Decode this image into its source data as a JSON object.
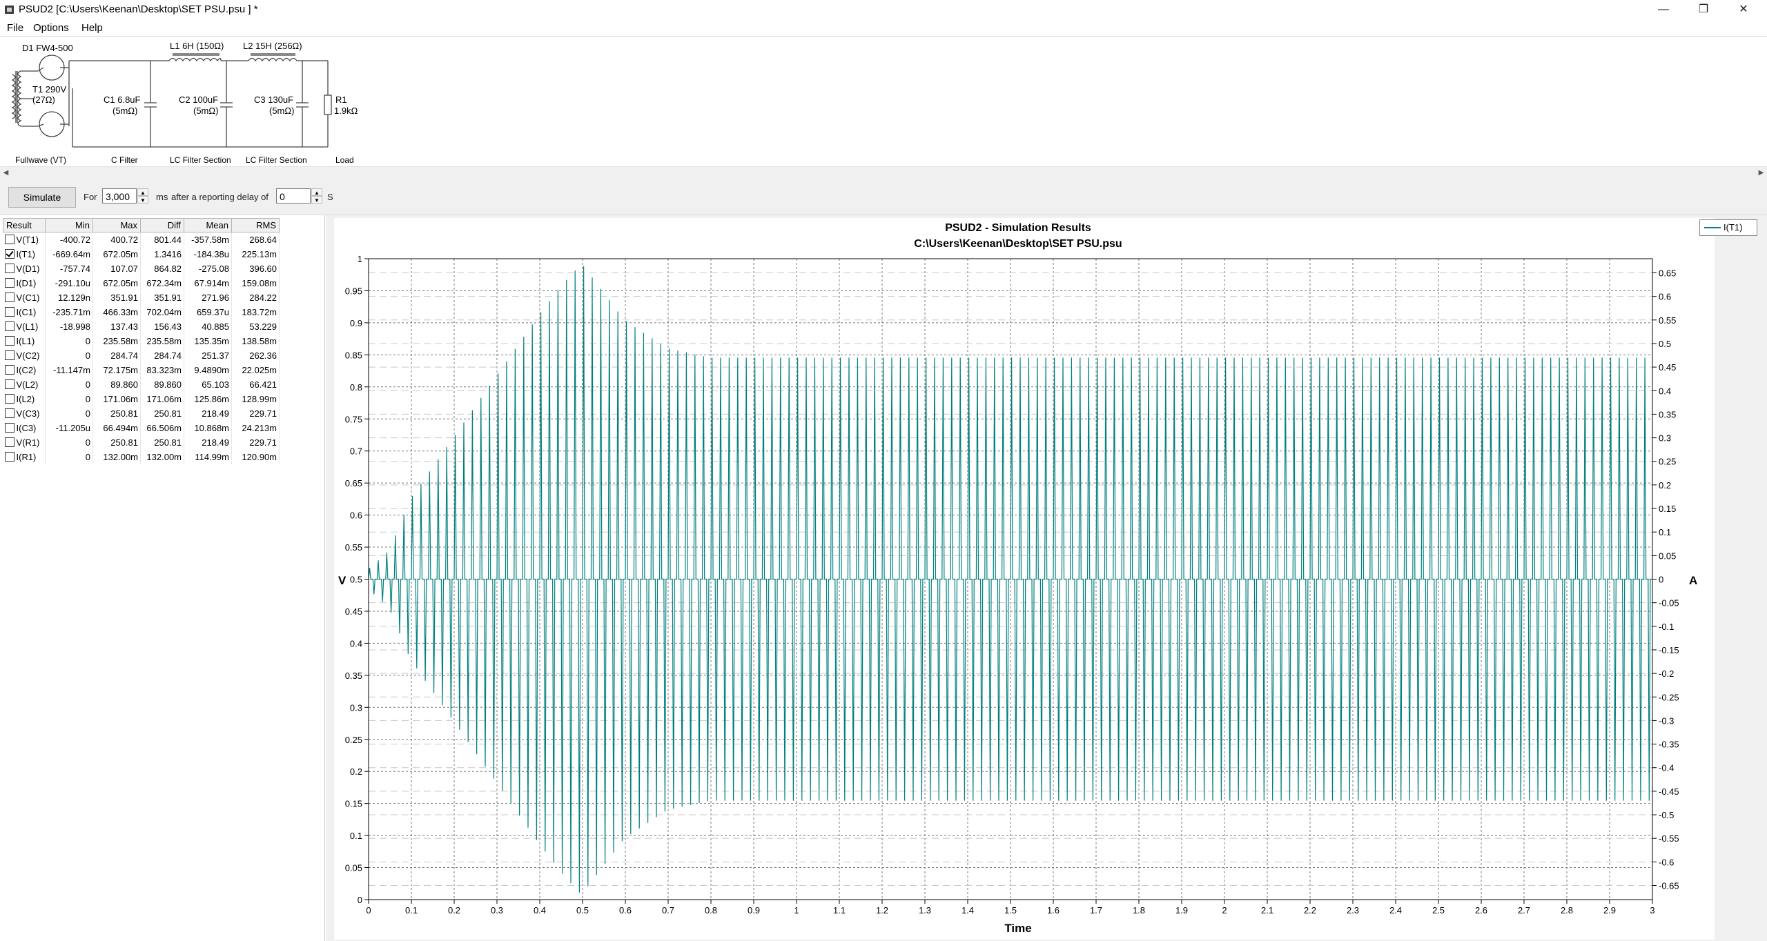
{
  "window": {
    "title": "PSUD2  [C:\\Users\\Keenan\\Desktop\\SET PSU.psu ] *",
    "minimize_glyph": "—",
    "restore_glyph": "❐",
    "close_glyph": "✕"
  },
  "menu": {
    "file": "File",
    "options": "Options",
    "help": "Help"
  },
  "schematic": {
    "d1": "D1 FW4-500",
    "t1_label": "T1 290V",
    "t1_res": "(27Ω)",
    "c1": "C1 6.8uF",
    "c1_res": "(5mΩ)",
    "l1": "L1 6H (150Ω)",
    "c2": "C2 100uF",
    "c2_res": "(5mΩ)",
    "l2": "L2 15H (256Ω)",
    "c3": "C3 130uF",
    "c3_res": "(5mΩ)",
    "r1": "R1",
    "r1_val": "1.9kΩ",
    "sec_fullwave": "Fullwave (VT)",
    "sec_cfilter": "C Filter",
    "sec_lc1": "LC Filter Section",
    "sec_lc2": "LC Filter Section",
    "sec_load": "Load"
  },
  "simbar": {
    "simulate": "Simulate",
    "for": "For",
    "duration": "3,000",
    "ms": "ms",
    "after": "after a reporting delay of",
    "delay": "0",
    "s": "S"
  },
  "results": {
    "headers": [
      "Result",
      "Min",
      "Max",
      "Diff",
      "Mean",
      "RMS"
    ],
    "rows": [
      {
        "name": "V(T1)",
        "checked": false,
        "min": "-400.72",
        "max": "400.72",
        "diff": "801.44",
        "mean": "-357.58m",
        "rms": "268.64"
      },
      {
        "name": "I(T1)",
        "checked": true,
        "min": "-669.64m",
        "max": "672.05m",
        "diff": "1.3416",
        "mean": "-184.38u",
        "rms": "225.13m"
      },
      {
        "name": "V(D1)",
        "checked": false,
        "min": "-757.74",
        "max": "107.07",
        "diff": "864.82",
        "mean": "-275.08",
        "rms": "396.60"
      },
      {
        "name": "I(D1)",
        "checked": false,
        "min": "-291.10u",
        "max": "672.05m",
        "diff": "672.34m",
        "mean": "67.914m",
        "rms": "159.08m"
      },
      {
        "name": "V(C1)",
        "checked": false,
        "min": "12.129n",
        "max": "351.91",
        "diff": "351.91",
        "mean": "271.96",
        "rms": "284.22"
      },
      {
        "name": "I(C1)",
        "checked": false,
        "min": "-235.71m",
        "max": "466.33m",
        "diff": "702.04m",
        "mean": "659.37u",
        "rms": "183.72m"
      },
      {
        "name": "V(L1)",
        "checked": false,
        "min": "-18.998",
        "max": "137.43",
        "diff": "156.43",
        "mean": "40.885",
        "rms": "53.229"
      },
      {
        "name": "I(L1)",
        "checked": false,
        "min": "0",
        "max": "235.58m",
        "diff": "235.58m",
        "mean": "135.35m",
        "rms": "138.58m"
      },
      {
        "name": "V(C2)",
        "checked": false,
        "min": "0",
        "max": "284.74",
        "diff": "284.74",
        "mean": "251.37",
        "rms": "262.36"
      },
      {
        "name": "I(C2)",
        "checked": false,
        "min": "-11.147m",
        "max": "72.175m",
        "diff": "83.323m",
        "mean": "9.4890m",
        "rms": "22.025m"
      },
      {
        "name": "V(L2)",
        "checked": false,
        "min": "0",
        "max": "89.860",
        "diff": "89.860",
        "mean": "65.103",
        "rms": "66.421"
      },
      {
        "name": "I(L2)",
        "checked": false,
        "min": "0",
        "max": "171.06m",
        "diff": "171.06m",
        "mean": "125.86m",
        "rms": "128.99m"
      },
      {
        "name": "V(C3)",
        "checked": false,
        "min": "0",
        "max": "250.81",
        "diff": "250.81",
        "mean": "218.49",
        "rms": "229.71"
      },
      {
        "name": "I(C3)",
        "checked": false,
        "min": "-11.205u",
        "max": "66.494m",
        "diff": "66.506m",
        "mean": "10.868m",
        "rms": "24.213m"
      },
      {
        "name": "V(R1)",
        "checked": false,
        "min": "0",
        "max": "250.81",
        "diff": "250.81",
        "mean": "218.49",
        "rms": "229.71"
      },
      {
        "name": "I(R1)",
        "checked": false,
        "min": "0",
        "max": "132.00m",
        "diff": "132.00m",
        "mean": "114.99m",
        "rms": "120.90m"
      }
    ]
  },
  "chart_data": {
    "type": "line",
    "title": "PSUD2 - Simulation Results",
    "subtitle": "C:\\Users\\Keenan\\Desktop\\SET PSU.psu",
    "xlabel": "Time",
    "ylabel_left": "V",
    "ylabel_right": "A",
    "xlim": [
      0,
      3
    ],
    "ylim_left": [
      0,
      1
    ],
    "ylim_right": [
      -0.68,
      0.68
    ],
    "x_ticks": [
      "0",
      "0.1",
      "0.2",
      "0.3",
      "0.4",
      "0.5",
      "0.6",
      "0.7",
      "0.8",
      "0.9",
      "1",
      "1.1",
      "1.2",
      "1.3",
      "1.4",
      "1.5",
      "1.6",
      "1.7",
      "1.8",
      "1.9",
      "2",
      "2.1",
      "2.2",
      "2.3",
      "2.4",
      "2.5",
      "2.6",
      "2.7",
      "2.8",
      "2.9",
      "3"
    ],
    "y_left_ticks": [
      "0",
      "0.05",
      "0.1",
      "0.15",
      "0.2",
      "0.25",
      "0.3",
      "0.35",
      "0.4",
      "0.45",
      "0.5",
      "0.55",
      "0.6",
      "0.65",
      "0.7",
      "0.75",
      "0.8",
      "0.85",
      "0.9",
      "0.95",
      "1"
    ],
    "y_right_ticks": [
      "-0.65",
      "-0.6",
      "-0.55",
      "-0.5",
      "-0.45",
      "-0.4",
      "-0.35",
      "-0.3",
      "-0.25",
      "-0.2",
      "-0.15",
      "-0.1",
      "-0.05",
      "0",
      "0.05",
      "0.1",
      "0.15",
      "0.2",
      "0.25",
      "0.3",
      "0.35",
      "0.4",
      "0.45",
      "0.5",
      "0.55",
      "0.6",
      "0.65"
    ],
    "grid": true,
    "legend_position": "top-right",
    "series": [
      {
        "name": "I(T1)",
        "color": "#007f7f",
        "axis": "right",
        "pulse_period_s": 0.01,
        "envelope": {
          "x": [
            0,
            0.05,
            0.1,
            0.2,
            0.3,
            0.4,
            0.45,
            0.5,
            0.55,
            0.6,
            0.7,
            0.8,
            3.0
          ],
          "peak_A": [
            0.02,
            0.06,
            0.17,
            0.3,
            0.43,
            0.56,
            0.62,
            0.67,
            0.61,
            0.55,
            0.49,
            0.47,
            0.47
          ]
        }
      }
    ]
  }
}
